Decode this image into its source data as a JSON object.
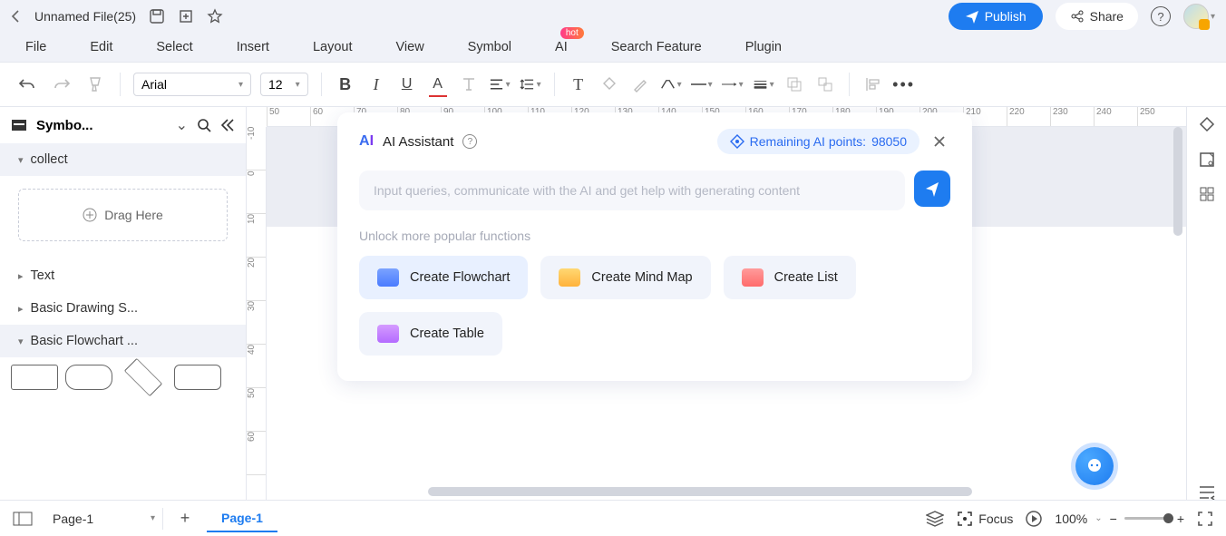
{
  "titlebar": {
    "filename": "Unnamed File(25)",
    "publish": "Publish",
    "share": "Share"
  },
  "menubar": {
    "file": "File",
    "edit": "Edit",
    "select": "Select",
    "insert": "Insert",
    "layout": "Layout",
    "view": "View",
    "symbol": "Symbol",
    "ai": "AI",
    "hot": "hot",
    "search": "Search Feature",
    "plugin": "Plugin"
  },
  "toolbar": {
    "font": "Arial",
    "size": "12"
  },
  "sidebar": {
    "title": "Symbo...",
    "sections": {
      "collect": "collect",
      "text": "Text",
      "basicDrawing": "Basic Drawing S...",
      "basicFlowchart": "Basic Flowchart ..."
    },
    "dragHere": "Drag Here"
  },
  "ruler_h": [
    "50",
    "60",
    "70",
    "80",
    "90",
    "100",
    "110",
    "120",
    "130",
    "140",
    "150",
    "160",
    "170",
    "180",
    "190",
    "200",
    "210",
    "220",
    "230",
    "240",
    "250"
  ],
  "ruler_v": [
    "-10",
    "0",
    "10",
    "20",
    "30",
    "40",
    "50",
    "60"
  ],
  "ai": {
    "title": "AI Assistant",
    "points_label": "Remaining AI points: ",
    "points_value": "98050",
    "placeholder": "Input queries, communicate with the AI and get help with generating content",
    "hint": "Unlock more popular functions",
    "actions": {
      "flowchart": "Create Flowchart",
      "mindmap": "Create Mind Map",
      "list": "Create List",
      "table": "Create Table"
    }
  },
  "bottombar": {
    "pageSel": "Page-1",
    "pageTab": "Page-1",
    "focus": "Focus",
    "zoom": "100%"
  }
}
